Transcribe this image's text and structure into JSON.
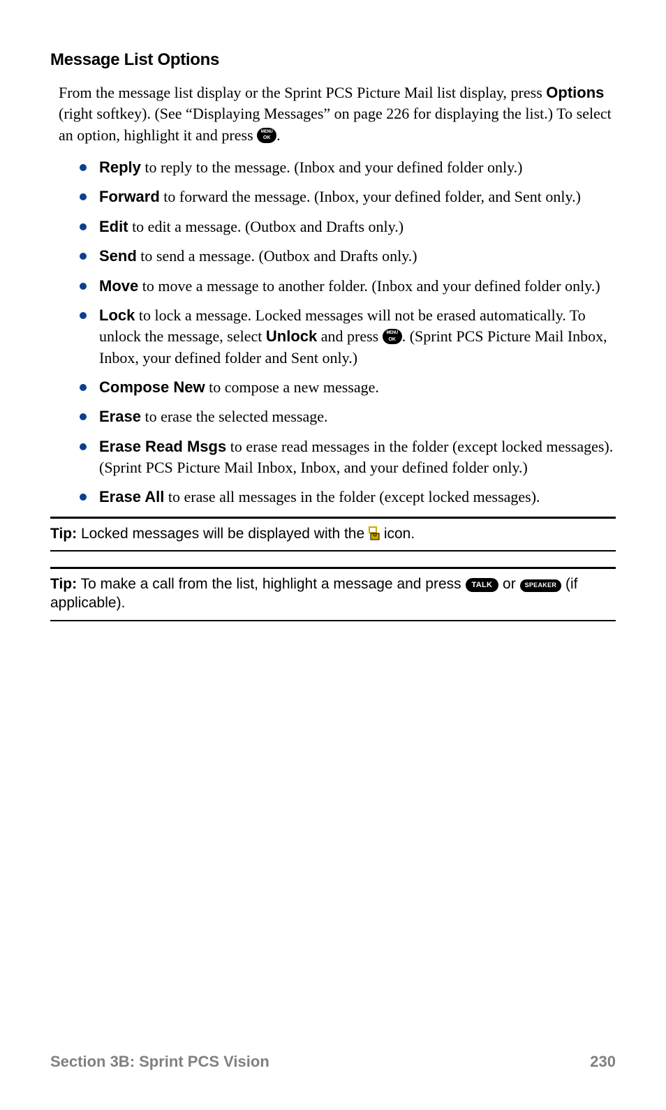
{
  "heading": "Message List Options",
  "intro": {
    "part1": "From the message list display or the Sprint PCS Picture Mail list display, press ",
    "options_bold": "Options",
    "part2": " (right softkey). (See “Displaying Messages” on page 226 for displaying the list.) To select an option, highlight it and press ",
    "period": "."
  },
  "options": [
    {
      "term": "Reply",
      "desc": " to reply to the message. (Inbox and your defined folder only.)"
    },
    {
      "term": "Forward",
      "desc": " to forward the message. (Inbox, your defined folder, and Sent only.)"
    },
    {
      "term": "Edit",
      "desc": " to edit a message. (Outbox and Drafts only.)"
    },
    {
      "term": "Send",
      "desc": " to send a message. (Outbox and Drafts only.)"
    },
    {
      "term": "Move",
      "desc": " to move a message to another folder. (Inbox and your defined folder only.)"
    },
    {
      "term": "Lock",
      "desc_before": " to lock a message. Locked messages will not be erased automatically. To unlock the message, select ",
      "unlock_bold": "Unlock",
      "desc_mid": " and press ",
      "desc_after": ". (Sprint PCS Picture Mail Inbox, Inbox, your defined folder and Sent only.)"
    },
    {
      "term": "Compose New",
      "desc": " to compose a new message."
    },
    {
      "term": "Erase",
      "desc": " to erase the selected message."
    },
    {
      "term": "Erase Read Msgs",
      "desc": " to erase read messages in the folder (except locked messages). (Sprint PCS Picture Mail Inbox, Inbox, and your defined folder only.)"
    },
    {
      "term": "Erase All",
      "desc": " to erase all messages in the folder (except locked messages)."
    }
  ],
  "tip1": {
    "label": "Tip:",
    "text_before": " Locked messages will be displayed with the ",
    "text_after": " icon."
  },
  "tip2": {
    "label": "Tip:",
    "text_before": " To make a call from the list, highlight a message and press ",
    "talk": "TALK",
    "or": " or ",
    "speaker": "SPEAKER",
    "text_after": " (if applicable)."
  },
  "footer": {
    "left": "Section 3B: Sprint PCS Vision",
    "right": "230"
  }
}
